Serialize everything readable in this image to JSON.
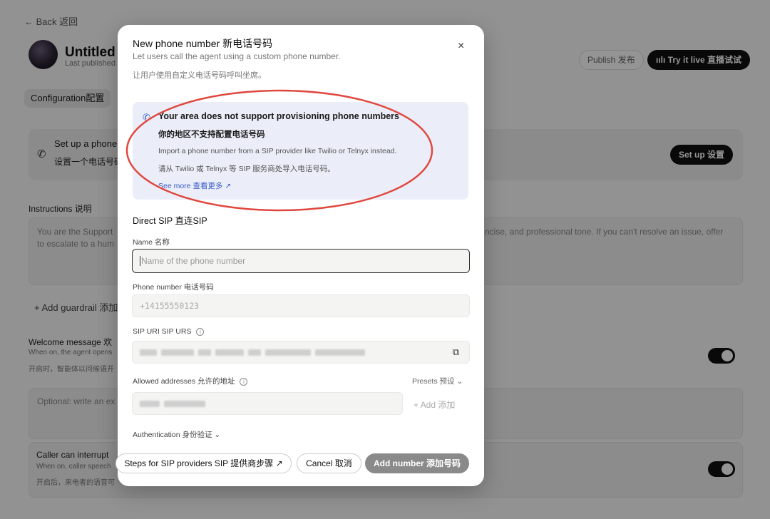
{
  "background": {
    "back_label": "← Back 返回",
    "page_title": "Untitled 未",
    "last_published": "Last published",
    "publish_label": "Publish 发布",
    "try_label": "ıılı Try it live 直播试试",
    "config_tab": "Configuration配置",
    "setup_line1": "Set up a phone n",
    "setup_line2": "设置一个电话号码",
    "setup_button": "Set up 设置",
    "instructions_label": "Instructions 说明",
    "instructions_text1": "You are the Support",
    "instructions_text2": "to escalate to a hum",
    "instructions_text_right": "ncise, and professional tone. If you can't resolve an issue, offer",
    "add_guardrail": "+ Add guardrail 添加",
    "welcome_title": "Welcome message 欢",
    "welcome_desc_en": "When on, the agent opens",
    "welcome_desc_zh": "开启时，智能体以问候语开",
    "optional_placeholder": "Optional: write an ex",
    "caller_title": "Caller can interrupt",
    "caller_desc_en": "When on, caller speech",
    "caller_desc_zh": "开启后，来电者的语音可"
  },
  "modal": {
    "title": "New phone number 新电话号码",
    "subtitle_en": "Let users call the agent using a custom phone number.",
    "subtitle_zh": "让用户使用自定义电话号码呼叫坐席。",
    "close_icon": "×",
    "alert": {
      "heading_en": "Your area does not support provisioning phone numbers",
      "heading_zh": "你的地区不支持配置电话号码",
      "body_en": "Import a phone number from a SIP provider like Twilio or Telnyx instead.",
      "body_zh": "请从 Twilio 或 Telnyx 等 SIP 服务商处导入电话号码。",
      "link": "See more 查看更多 ↗"
    },
    "section_title": "Direct SIP 直连SIP",
    "name_label": "Name 名称",
    "name_placeholder": "Name of the phone number",
    "phone_label": "Phone number 电话号码",
    "phone_placeholder": "+14155550123",
    "sip_label": "SIP URI SIP URS",
    "allowed_label": "Allowed addresses 允许的地址",
    "presets_label": "Presets 预设 ⌄",
    "add_label": "+ Add 添加",
    "auth_label": "Authentication 身份验证 ⌄",
    "steps_button": "Steps for SIP providers SIP 提供商步骤 ↗",
    "cancel_button": "Cancel 取消",
    "add_number_button": "Add number 添加号码"
  },
  "colors": {
    "alert_bg": "#ebeef8",
    "link": "#3a5bc7",
    "annotation_circle": "#e0483f",
    "primary_dark": "#111111"
  }
}
